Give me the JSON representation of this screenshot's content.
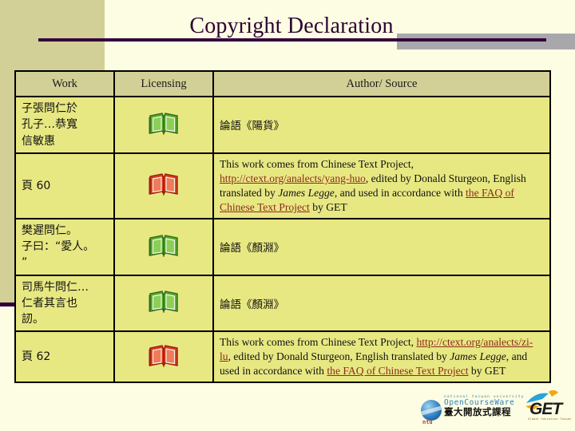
{
  "slide": {
    "title": "Copyright Declaration",
    "accent_color": "#33003b",
    "sidebar_color": "#d2d096",
    "background_color": "#fdfde3",
    "gray_bar_color": "#a8a8ac",
    "table_header_color": "#d2d096",
    "table_body_color": "#e8e883",
    "link_color": "#8c2b1c"
  },
  "table": {
    "headers": {
      "work": "Work",
      "licensing": "Licensing",
      "source": "Author/ Source"
    },
    "rows": [
      {
        "work": "子張問仁於\n孔子…恭寬\n信敏惠",
        "license_icon": "green-open-book-icon",
        "license_icon_color": "#4a9a2a",
        "source_type": "cjk",
        "source": "論語《陽貨》"
      },
      {
        "work": "頁 60",
        "license_icon": "red-open-book-icon",
        "license_icon_color": "#d83a1e",
        "source_type": "en",
        "source_parts": [
          {
            "text": "This work comes from Chinese Text Project, ",
            "style": "plain"
          },
          {
            "text": "http://ctext.org/analects/yang-huo",
            "style": "link"
          },
          {
            "text": ", edited by Donald Sturgeon, English translated by ",
            "style": "plain"
          },
          {
            "text": "James Legge",
            "style": "italic"
          },
          {
            "text": ", and used in accordance with ",
            "style": "plain"
          },
          {
            "text": "the FAQ of Chinese Text Project",
            "style": "link"
          },
          {
            "text": " by GET",
            "style": "plain"
          }
        ]
      },
      {
        "work": "樊遲問仁。\n子曰：“愛人。\n”",
        "license_icon": "green-open-book-icon",
        "license_icon_color": "#4a9a2a",
        "source_type": "cjk",
        "source": "論語《顏淵》"
      },
      {
        "work": "司馬牛問仁…\n仁者其言也\n訒。",
        "license_icon": "green-open-book-icon",
        "license_icon_color": "#4a9a2a",
        "source_type": "cjk",
        "source": "論語《顏淵》"
      },
      {
        "work": "頁 62",
        "license_icon": "red-open-book-icon",
        "license_icon_color": "#d83a1e",
        "source_type": "en",
        "source_parts": [
          {
            "text": "This work comes from Chinese Text Project, ",
            "style": "plain"
          },
          {
            "text": "http://ctext.org/analects/zi-lu",
            "style": "link"
          },
          {
            "text": ", edited by Donald Sturgeon, English translated by ",
            "style": "plain"
          },
          {
            "text": "James Legge",
            "style": "italic"
          },
          {
            "text": ", and used in accordance with ",
            "style": "plain"
          },
          {
            "text": "the FAQ of Chinese Text Project",
            "style": "link"
          },
          {
            "text": " by GET",
            "style": "plain"
          }
        ]
      }
    ]
  },
  "footer": {
    "ntu_line1": "national taiwan university",
    "ntu_line2": "OpenCourseWare",
    "ntu_line3": "臺大開放式課程",
    "ntu_mark": "ntu",
    "get_text": "GET",
    "get_sub": "Global Education Taiwan"
  }
}
